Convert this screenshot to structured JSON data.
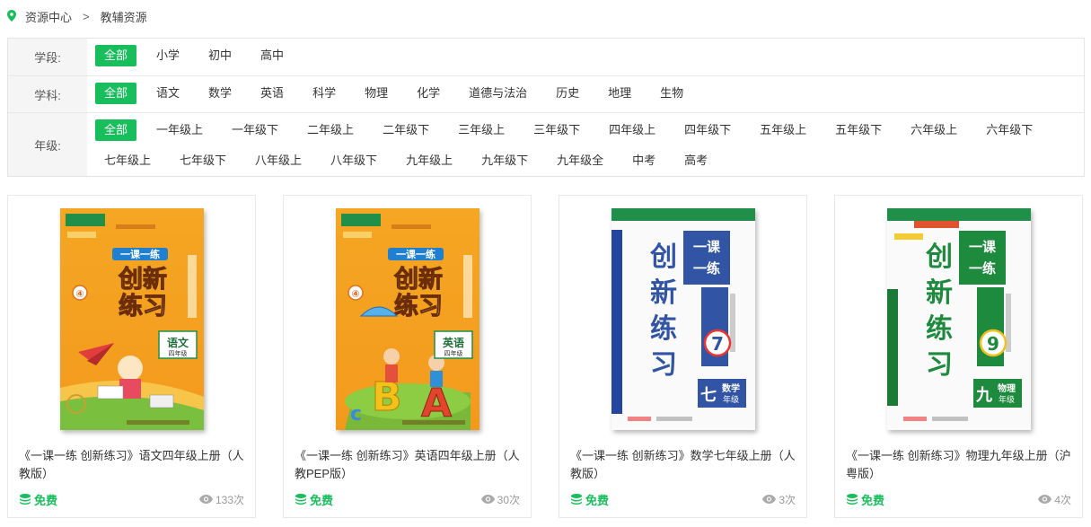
{
  "breadcrumb": {
    "home": "资源中心",
    "separator": ">",
    "current": "教辅资源"
  },
  "filters": {
    "stage": {
      "label": "学段:",
      "options": [
        "全部",
        "小学",
        "初中",
        "高中"
      ]
    },
    "subject": {
      "label": "学科:",
      "options": [
        "全部",
        "语文",
        "数学",
        "英语",
        "科学",
        "物理",
        "化学",
        "道德与法治",
        "历史",
        "地理",
        "生物"
      ]
    },
    "grade": {
      "label": "年级:",
      "options": [
        "全部",
        "一年级上",
        "一年级下",
        "二年级上",
        "二年级下",
        "三年级上",
        "三年级下",
        "四年级上",
        "四年级下",
        "五年级上",
        "五年级下",
        "六年级上",
        "六年级下",
        "七年级上",
        "七年级下",
        "八年级上",
        "八年级下",
        "九年级上",
        "九年级下",
        "九年级全",
        "中考",
        "高考"
      ]
    }
  },
  "colors": {
    "accent": "#18be5c"
  },
  "cards": [
    {
      "title": "《一课一练 创新练习》语文四年级上册（人教版）",
      "price": "免费",
      "views": "133次",
      "cover": {
        "series_small": "一课一练",
        "series": "创新练习",
        "subject": "语文",
        "grade": "四年级",
        "number": "④",
        "theme": "orange"
      }
    },
    {
      "title": "《一课一练 创新练习》英语四年级上册（人教PEP版）",
      "price": "免费",
      "views": "30次",
      "cover": {
        "series_small": "一课一练",
        "series": "创新练习",
        "subject": "英语",
        "grade": "四年级",
        "number": "④",
        "theme": "orange-abc"
      }
    },
    {
      "title": "《一课一练 创新练习》数学七年级上册（人教版）",
      "price": "免费",
      "views": "3次",
      "cover": {
        "series_small": "一课一练",
        "series": "创新练习",
        "subject": "数学",
        "grade": "年级",
        "number": "7",
        "theme": "blue"
      }
    },
    {
      "title": "《一课一练 创新练习》物理九年级上册（沪粤版）",
      "price": "免费",
      "views": "4次",
      "cover": {
        "series_small": "一课一练",
        "series": "创新练习",
        "subject": "物理",
        "grade": "年级",
        "number": "9",
        "theme": "green"
      }
    }
  ]
}
